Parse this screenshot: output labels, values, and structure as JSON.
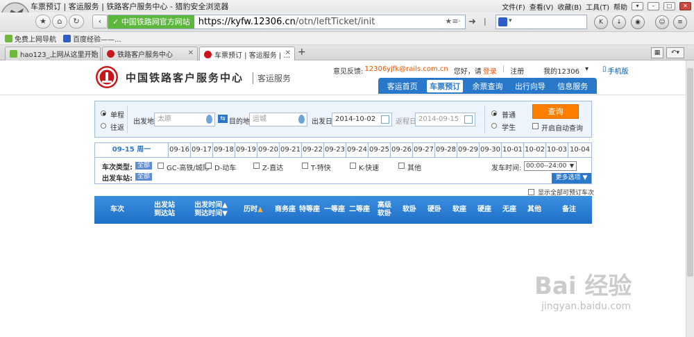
{
  "browser": {
    "title": "车票预订 | 客运服务 | 铁路客户服务中心 - 猎豹安全浏览器",
    "menus": [
      "文件(F)",
      "查看(V)",
      "收藏(B)",
      "工具(T)",
      "帮助"
    ],
    "site_id": "中国铁路网官方网站",
    "url_domain": "https://kyfw.12306.cn",
    "url_path": "/otn/leftTicket/init",
    "favorites": [
      "免费上网导航",
      "百度经验——..."
    ],
    "tabs": [
      "hao123_上网从这里开始",
      "铁路客户服务中心",
      "车票预订 | 客运服务 | ..."
    ],
    "new_tab": "+"
  },
  "header": {
    "brand": "中国铁路客户服务中心",
    "sub": "客运服务",
    "feedback_label": "意见反馈:",
    "feedback_email": "12306yjfk@rails.com.cn",
    "greeting": "您好，请",
    "login": "登录",
    "register": "注册",
    "my12306": "我的12306",
    "mobile": "手机版",
    "nav": [
      "客运首页",
      "车票预订",
      "余票查询",
      "出行向导",
      "信息服务"
    ]
  },
  "query": {
    "trip_oneway": "单程",
    "trip_round": "往返",
    "from_label": "出发地",
    "from_value": "太原",
    "to_label": "目的地",
    "to_value": "运城",
    "date_label": "出发日",
    "date_value": "2014-10-02",
    "return_label": "返程日",
    "return_value": "2014-09-15",
    "type_normal": "普通",
    "type_student": "学生",
    "search": "查询",
    "auto_query": "开启自动查询"
  },
  "dates": [
    "09-15 周一",
    "09-16",
    "09-17",
    "09-18",
    "09-19",
    "09-20",
    "09-21",
    "09-22",
    "09-23",
    "09-24",
    "09-25",
    "09-26",
    "09-27",
    "09-28",
    "09-29",
    "09-30",
    "10-01",
    "10-02",
    "10-03",
    "10-04"
  ],
  "filters": {
    "train_type_label": "车次类型:",
    "all": "全部",
    "types": [
      "GC-高铁/城际",
      "D-动车",
      "Z-直达",
      "T-特快",
      "K-快速",
      "其他"
    ],
    "depart_time_label": "发车时间:",
    "depart_time_value": "00:00--24:00",
    "station_label": "出发车站:",
    "more": "更多选项",
    "show_all": "显示全部可预订车次"
  },
  "columns": [
    "车次",
    "出发站",
    "到达站",
    "出发时间",
    "到达时间",
    "历时",
    "商务座",
    "特等座",
    "一等座",
    "二等座",
    "高级",
    "软卧",
    "软卧",
    "硬卧",
    "软座",
    "硬座",
    "无座",
    "其他",
    "备注"
  ],
  "watermark": {
    "main": "Bai 经验",
    "sub": "jingyan.baidu.com"
  },
  "colors": {
    "brand_red": "#c8161d",
    "nav_blue": "#2a78c9",
    "search_orange": "#ff7e00",
    "site_green": "#5cb83d"
  }
}
